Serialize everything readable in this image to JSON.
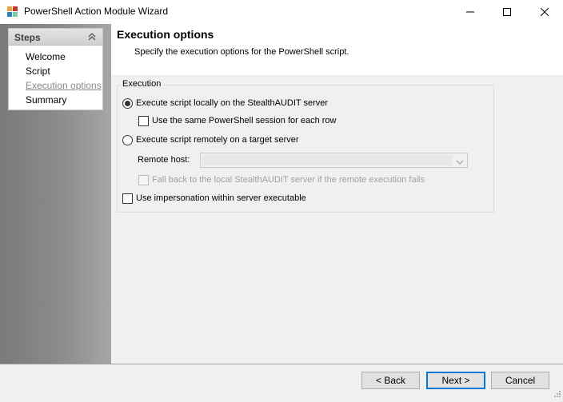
{
  "window": {
    "title": "PowerShell Action Module Wizard",
    "icons": {
      "app": "wizard-app-icon",
      "minimize": "minimize-icon",
      "maximize": "maximize-icon",
      "close": "close-icon"
    }
  },
  "sidebar": {
    "title": "Steps",
    "collapse_icon": "double-chevron-up-icon",
    "items": [
      {
        "label": "Welcome",
        "state": "done"
      },
      {
        "label": "Script",
        "state": "done"
      },
      {
        "label": "Execution options",
        "state": "current"
      },
      {
        "label": "Summary",
        "state": "pending"
      }
    ]
  },
  "header": {
    "title": "Execution options",
    "subtitle": "Specify the execution options for the PowerShell script."
  },
  "execution": {
    "legend": "Execution",
    "local_radio": {
      "label": "Execute script locally on the StealthAUDIT server",
      "selected": true
    },
    "same_session_checkbox": {
      "label": "Use the same PowerShell session for each row",
      "checked": false
    },
    "remote_radio": {
      "label": "Execute script remotely on a target server",
      "selected": false
    },
    "remote_host": {
      "label": "Remote host:",
      "value": "",
      "enabled": false
    },
    "fallback_checkbox": {
      "label": "Fall back to the local StealthAUDIT server if the remote execution fails",
      "checked": false,
      "enabled": false
    },
    "impersonation_checkbox": {
      "label": "Use impersonation within server executable",
      "checked": false
    }
  },
  "footer": {
    "back_label": "< Back",
    "next_label": "Next >",
    "cancel_label": "Cancel"
  },
  "colors": {
    "accent": "#0078d7",
    "sidebar_gradient_start": "#7a7a7a",
    "sidebar_gradient_end": "#a6a6a6",
    "current_step_text": "#8a8a8a"
  }
}
